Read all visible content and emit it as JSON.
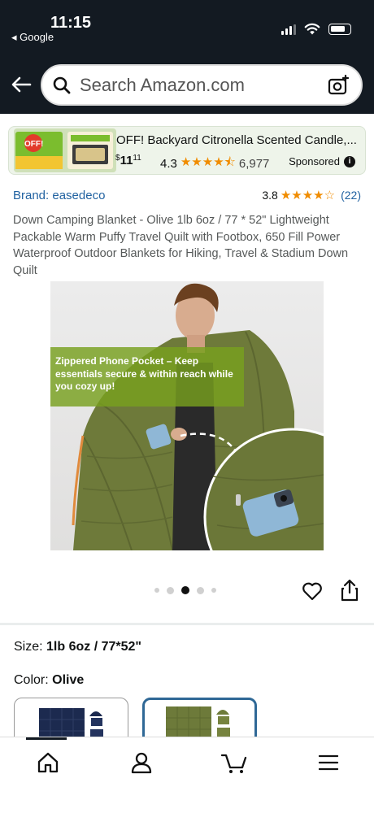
{
  "status_bar": {
    "time": "11:15",
    "back_app": "◂ Google"
  },
  "header": {
    "search_placeholder": "Search Amazon.com",
    "icons": [
      "back-arrow-icon",
      "search-icon",
      "camera-search-icon"
    ]
  },
  "sponsored": {
    "title": "OFF! Backyard Citronella Scented Candle,...",
    "price_dollars": "11",
    "price_cents": "11",
    "price_symbol": "$",
    "rating": "4.3",
    "stars": "★★★★⯪",
    "review_count": "6,977",
    "label": "Sponsored",
    "info_glyph": "i"
  },
  "product": {
    "brand": "Brand: easedeco",
    "rating": "3.8",
    "stars": "★★★★☆",
    "review_count": "(22)",
    "title": "Down Camping Blanket - Olive 1lb 6oz / 77 * 52\" Lightweight Packable Warm Puffy Travel Quilt with Footbox, 650 Fill Power Waterproof Outdoor Blankets for Hiking, Travel & Stadium Down Quilt",
    "image_callout": "Zippered Phone Pocket – Keep essentials secure & within reach while you cozy up!",
    "carousel_total": 5,
    "carousel_active": 3
  },
  "options": {
    "size_label": "Size:",
    "size_value": "1lb 6oz / 77*52\"",
    "color_label": "Color:",
    "color_value": "Olive",
    "swatches": [
      {
        "name": "Navy",
        "selected": false,
        "color": "#1c2a4f"
      },
      {
        "name": "Olive",
        "selected": true,
        "color": "#6d7a3a"
      }
    ]
  },
  "tabbar": {
    "items": [
      "home-icon",
      "account-icon",
      "cart-icon",
      "menu-icon"
    ],
    "active": "home-icon"
  },
  "colors": {
    "header_bg": "#131a22",
    "link": "#2162a1",
    "star": "#f08c00",
    "callout_bg": "#78a01e",
    "selected_swatch_border": "#2f6896"
  }
}
